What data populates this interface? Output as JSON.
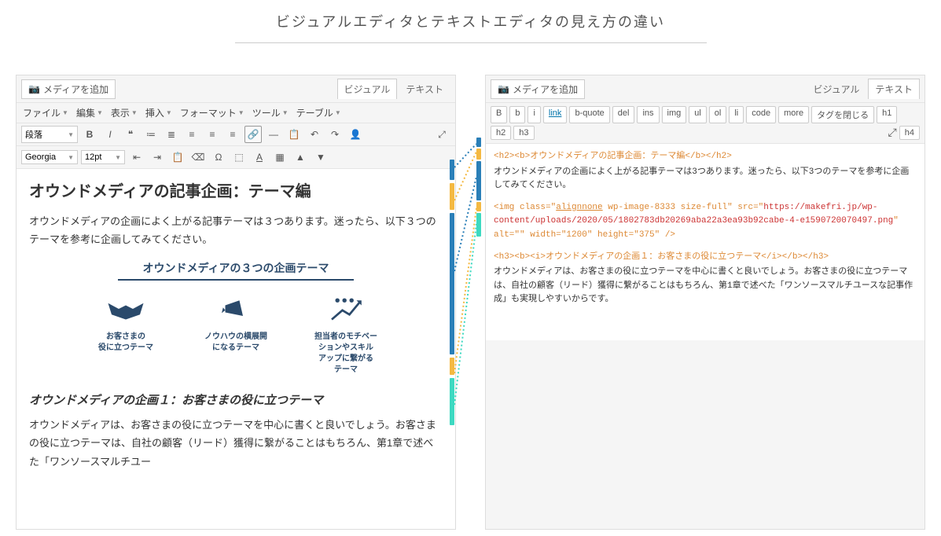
{
  "page_title": "ビジュアルエディタとテキストエディタの見え方の違い",
  "left": {
    "media_btn": "メディアを追加",
    "tabs": {
      "visual": "ビジュアル",
      "text": "テキスト"
    },
    "menus": [
      "ファイル",
      "編集",
      "表示",
      "挿入",
      "フォーマット",
      "ツール",
      "テーブル"
    ],
    "para_sel": "段落",
    "font_sel": "Georgia",
    "size_sel": "12pt",
    "content": {
      "h2": "オウンドメディアの記事企画：テーマ編",
      "p1": "オウンドメディアの企画によく上がる記事テーマは３つあります。迷ったら、以下３つのテーマを参考に企画してみてください。",
      "img_title": "オウンドメディアの３つの企画テーマ",
      "col1": "お客さまの\n役に立つテーマ",
      "col2": "ノウハウの横展開\nになるテーマ",
      "col3": "担当者のモチベー\nションやスキル\nアップに繋がる\nテーマ",
      "h3": "オウンドメディアの企画１：お客さまの役に立つテーマ",
      "p2": "オウンドメディアは、お客さまの役に立つテーマを中心に書くと良いでしょう。お客さまの役に立つテーマは、自社の顧客（リード）獲得に繋がることはもちろん、第1章で述べた「ワンソースマルチユー"
    }
  },
  "right": {
    "media_btn": "メディアを追加",
    "tabs": {
      "visual": "ビジュアル",
      "text": "テキスト"
    },
    "buttons": [
      "B",
      "b",
      "i",
      "link",
      "b-quote",
      "del",
      "ins",
      "img",
      "ul",
      "ol",
      "li",
      "code",
      "more",
      "タグを閉じる",
      "h1",
      "h2",
      "h3",
      "h4"
    ],
    "code": {
      "l1": "<h2><b>オウンドメディアの記事企画：テーマ編</b></h2>",
      "l2": "オウンドメディアの企画によく上がる記事テーマは3つあります。迷ったら、以下3つのテーマを参考に企画してみてください。",
      "l3a": "<img class=\"",
      "l3b": "alignnone",
      "l3c": " wp-image-8333 size-full\" src=\"",
      "l3d": "https://makefri.jp/wp-content/uploads/2020/05/1802783db20269aba22a3ea93b92cabe-4-e1590720070497.png",
      "l3e": "\" alt=\"\" width=\"1200\" height=\"375\" />",
      "l4": "<h3><b><i>オウンドメディアの企画１：お客さまの役に立つテーマ</i></b></h3>",
      "l5": "オウンドメディアは、お客さまの役に立つテーマを中心に書くと良いでしょう。お客さまの役に立つテーマは、自社の顧客（リード）獲得に繋がることはもちろん、第1章で述べた「ワンソースマルチユースな記事作成」も実現しやすいからです。"
    }
  }
}
